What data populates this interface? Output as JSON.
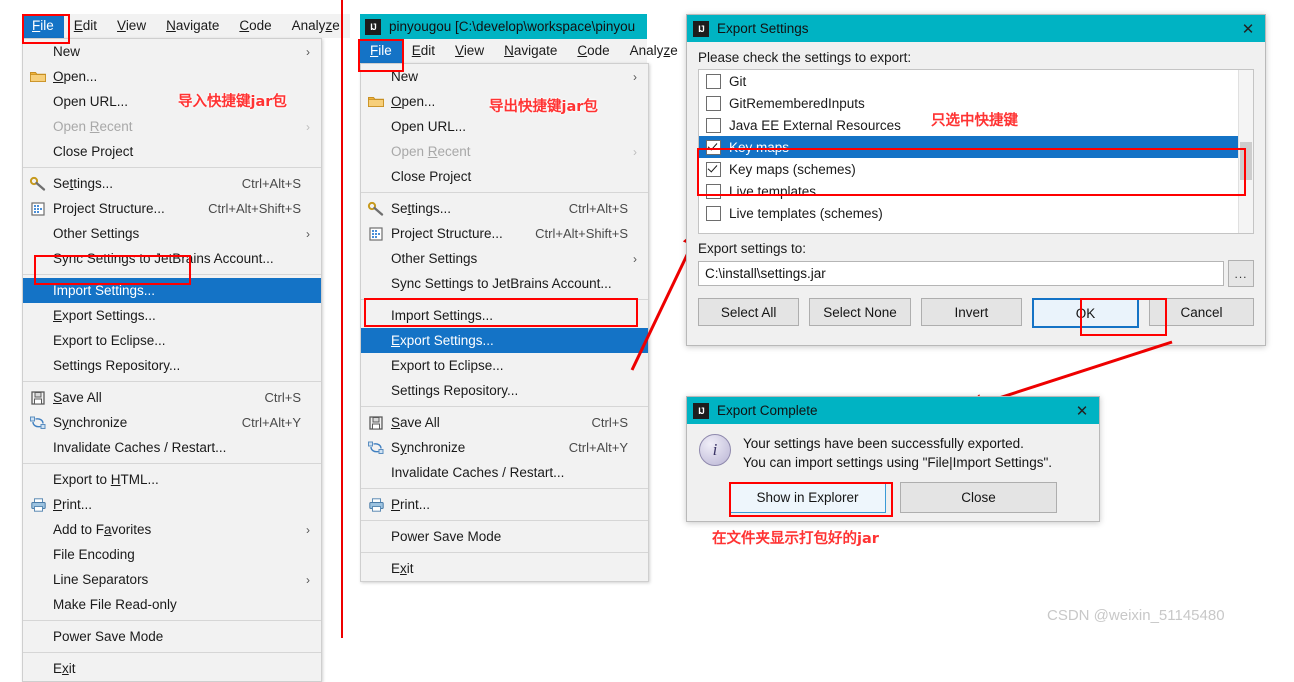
{
  "panel_left": {
    "menubar": {
      "items": [
        {
          "label": "File",
          "mnemonic": "F",
          "active": true
        },
        {
          "label": "Edit",
          "mnemonic": "E",
          "active": false
        },
        {
          "label": "View",
          "mnemonic": "V",
          "active": false
        },
        {
          "label": "Navigate",
          "mnemonic": "N",
          "active": false
        },
        {
          "label": "Code",
          "mnemonic": "C",
          "active": false
        },
        {
          "label": "Analyze",
          "mnemonic": "z",
          "active": false
        }
      ]
    },
    "menu_items": [
      {
        "label": "New",
        "accel": "",
        "icon": "",
        "submenu": true,
        "disabled": false,
        "selected": false
      },
      {
        "label": "Open...",
        "mnemonic": "O",
        "accel": "",
        "icon": "folder-icon",
        "submenu": false,
        "disabled": false,
        "selected": false
      },
      {
        "label": "Open URL...",
        "accel": "",
        "icon": "",
        "submenu": false,
        "disabled": false,
        "selected": false
      },
      {
        "label": "Open Recent",
        "mnemonic": "R",
        "accel": "",
        "icon": "",
        "submenu": true,
        "disabled": true,
        "selected": false
      },
      {
        "label": "Close Project",
        "accel": "",
        "icon": "",
        "submenu": false,
        "disabled": false,
        "selected": false
      },
      {
        "separator": true
      },
      {
        "label": "Settings...",
        "mnemonic": "t",
        "accel": "Ctrl+Alt+S",
        "icon": "wrench-icon",
        "submenu": false,
        "disabled": false,
        "selected": false
      },
      {
        "label": "Project Structure...",
        "accel": "Ctrl+Alt+Shift+S",
        "icon": "structure-icon",
        "submenu": false,
        "disabled": false,
        "selected": false
      },
      {
        "label": "Other Settings",
        "accel": "",
        "icon": "",
        "submenu": true,
        "disabled": false,
        "selected": false
      },
      {
        "label": "Sync Settings to JetBrains Account...",
        "accel": "",
        "icon": "",
        "submenu": false,
        "disabled": false,
        "selected": false
      },
      {
        "separator": true
      },
      {
        "label": "Import Settings...",
        "accel": "",
        "icon": "",
        "submenu": false,
        "disabled": false,
        "selected": true
      },
      {
        "label": "Export Settings...",
        "mnemonic": "E",
        "accel": "",
        "icon": "",
        "submenu": false,
        "disabled": false,
        "selected": false
      },
      {
        "label": "Export to Eclipse...",
        "accel": "",
        "icon": "",
        "submenu": false,
        "disabled": false,
        "selected": false
      },
      {
        "label": "Settings Repository...",
        "accel": "",
        "icon": "",
        "submenu": false,
        "disabled": false,
        "selected": false
      },
      {
        "separator": true
      },
      {
        "label": "Save All",
        "mnemonic": "S",
        "accel": "Ctrl+S",
        "icon": "save-icon",
        "submenu": false,
        "disabled": false,
        "selected": false
      },
      {
        "label": "Synchronize",
        "mnemonic": "y",
        "accel": "Ctrl+Alt+Y",
        "icon": "sync-icon",
        "submenu": false,
        "disabled": false,
        "selected": false
      },
      {
        "label": "Invalidate Caches / Restart...",
        "accel": "",
        "icon": "",
        "submenu": false,
        "disabled": false,
        "selected": false
      },
      {
        "separator": true
      },
      {
        "label": "Export to HTML...",
        "mnemonic": "H",
        "accel": "",
        "icon": "",
        "submenu": false,
        "disabled": false,
        "selected": false
      },
      {
        "label": "Print...",
        "mnemonic": "P",
        "accel": "",
        "icon": "print-icon",
        "submenu": false,
        "disabled": false,
        "selected": false
      },
      {
        "label": "Add to Favorites",
        "mnemonic": "a",
        "accel": "",
        "icon": "",
        "submenu": true,
        "disabled": false,
        "selected": false
      },
      {
        "label": "File Encoding",
        "accel": "",
        "icon": "",
        "submenu": false,
        "disabled": false,
        "selected": false
      },
      {
        "label": "Line Separators",
        "accel": "",
        "icon": "",
        "submenu": true,
        "disabled": false,
        "selected": false
      },
      {
        "label": "Make File Read-only",
        "accel": "",
        "icon": "",
        "submenu": false,
        "disabled": false,
        "selected": false
      },
      {
        "separator": true
      },
      {
        "label": "Power Save Mode",
        "accel": "",
        "icon": "",
        "submenu": false,
        "disabled": false,
        "selected": false
      },
      {
        "separator": true
      },
      {
        "label": "Exit",
        "mnemonic": "x",
        "accel": "",
        "icon": "",
        "submenu": false,
        "disabled": false,
        "selected": false
      }
    ],
    "annotation": "导入快捷键jar包"
  },
  "panel_middle": {
    "window_title": "pinyougou [C:\\develop\\workspace\\pinyou",
    "menubar": {
      "items": [
        {
          "label": "File",
          "mnemonic": "F",
          "active": true
        },
        {
          "label": "Edit",
          "mnemonic": "E",
          "active": false
        },
        {
          "label": "View",
          "mnemonic": "V",
          "active": false
        },
        {
          "label": "Navigate",
          "mnemonic": "N",
          "active": false
        },
        {
          "label": "Code",
          "mnemonic": "C",
          "active": false
        },
        {
          "label": "Analyze",
          "mnemonic": "z",
          "active": false
        }
      ]
    },
    "menu_items": [
      {
        "label": "New",
        "accel": "",
        "icon": "",
        "submenu": true,
        "disabled": false,
        "selected": false
      },
      {
        "label": "Open...",
        "mnemonic": "O",
        "accel": "",
        "icon": "folder-icon",
        "submenu": false,
        "disabled": false,
        "selected": false
      },
      {
        "label": "Open URL...",
        "accel": "",
        "icon": "",
        "submenu": false,
        "disabled": false,
        "selected": false
      },
      {
        "label": "Open Recent",
        "mnemonic": "R",
        "accel": "",
        "icon": "",
        "submenu": true,
        "disabled": true,
        "selected": false
      },
      {
        "label": "Close Project",
        "accel": "",
        "icon": "",
        "submenu": false,
        "disabled": false,
        "selected": false
      },
      {
        "separator": true
      },
      {
        "label": "Settings...",
        "mnemonic": "t",
        "accel": "Ctrl+Alt+S",
        "icon": "wrench-icon",
        "submenu": false,
        "disabled": false,
        "selected": false
      },
      {
        "label": "Project Structure...",
        "accel": "Ctrl+Alt+Shift+S",
        "icon": "structure-icon",
        "submenu": false,
        "disabled": false,
        "selected": false
      },
      {
        "label": "Other Settings",
        "accel": "",
        "icon": "",
        "submenu": true,
        "disabled": false,
        "selected": false
      },
      {
        "label": "Sync Settings to JetBrains Account...",
        "accel": "",
        "icon": "",
        "submenu": false,
        "disabled": false,
        "selected": false
      },
      {
        "separator": true
      },
      {
        "label": "Import Settings...",
        "accel": "",
        "icon": "",
        "submenu": false,
        "disabled": false,
        "selected": false
      },
      {
        "label": "Export Settings...",
        "mnemonic": "E",
        "accel": "",
        "icon": "",
        "submenu": false,
        "disabled": false,
        "selected": true
      },
      {
        "label": "Export to Eclipse...",
        "accel": "",
        "icon": "",
        "submenu": false,
        "disabled": false,
        "selected": false
      },
      {
        "label": "Settings Repository...",
        "accel": "",
        "icon": "",
        "submenu": false,
        "disabled": false,
        "selected": false
      },
      {
        "separator": true
      },
      {
        "label": "Save All",
        "mnemonic": "S",
        "accel": "Ctrl+S",
        "icon": "save-icon",
        "submenu": false,
        "disabled": false,
        "selected": false
      },
      {
        "label": "Synchronize",
        "mnemonic": "y",
        "accel": "Ctrl+Alt+Y",
        "icon": "sync-icon",
        "submenu": false,
        "disabled": false,
        "selected": false
      },
      {
        "label": "Invalidate Caches / Restart...",
        "accel": "",
        "icon": "",
        "submenu": false,
        "disabled": false,
        "selected": false
      },
      {
        "separator": true
      },
      {
        "label": "Print...",
        "mnemonic": "P",
        "accel": "",
        "icon": "print-icon",
        "submenu": false,
        "disabled": false,
        "selected": false
      },
      {
        "separator": true
      },
      {
        "label": "Power Save Mode",
        "accel": "",
        "icon": "",
        "submenu": false,
        "disabled": false,
        "selected": false
      },
      {
        "separator": true
      },
      {
        "label": "Exit",
        "mnemonic": "x",
        "accel": "",
        "icon": "",
        "submenu": false,
        "disabled": false,
        "selected": false
      }
    ],
    "annotation": "导出快捷键jar包"
  },
  "export_dialog": {
    "title": "Export Settings",
    "close_label": "✕",
    "instruction": "Please check the settings to export:",
    "items": [
      {
        "label": "Git",
        "checked": false,
        "highlighted": false
      },
      {
        "label": "GitRememberedInputs",
        "checked": false,
        "highlighted": false
      },
      {
        "label": "Java EE External Resources",
        "checked": false,
        "highlighted": false
      },
      {
        "label": "Key maps",
        "checked": true,
        "highlighted": true
      },
      {
        "label": "Key maps (schemes)",
        "checked": true,
        "highlighted": false
      },
      {
        "label": "Live templates",
        "checked": false,
        "highlighted": false
      },
      {
        "label": "Live templates (schemes)",
        "checked": false,
        "highlighted": false
      }
    ],
    "path_label": "Export settings to:",
    "path_value": "C:\\install\\settings.jar",
    "browse_label": "...",
    "buttons": [
      {
        "label": "Select All",
        "default": false
      },
      {
        "label": "Select None",
        "default": false
      },
      {
        "label": "Invert",
        "default": false
      },
      {
        "label": "OK",
        "default": true
      },
      {
        "label": "Cancel",
        "default": false
      }
    ],
    "annotation": "只选中快捷键"
  },
  "complete_dialog": {
    "title": "Export Complete",
    "close_label": "✕",
    "icon": "info-icon",
    "message_line1": "Your settings have been successfully exported.",
    "message_line2": "You can import settings using \"File|Import Settings\".",
    "buttons": [
      {
        "label": "Show in Explorer",
        "default": true
      },
      {
        "label": "Close",
        "default": false
      }
    ],
    "annotation": "在文件夹显示打包好的jar"
  },
  "watermark": "CSDN @weixin_51145480",
  "colors": {
    "accent_teal": "#00b3c3",
    "selection_blue": "#1473c6",
    "annotation_red": "#ff3333",
    "arrow_red": "#ee0000",
    "watermark_gray": "#c8c8c8"
  }
}
